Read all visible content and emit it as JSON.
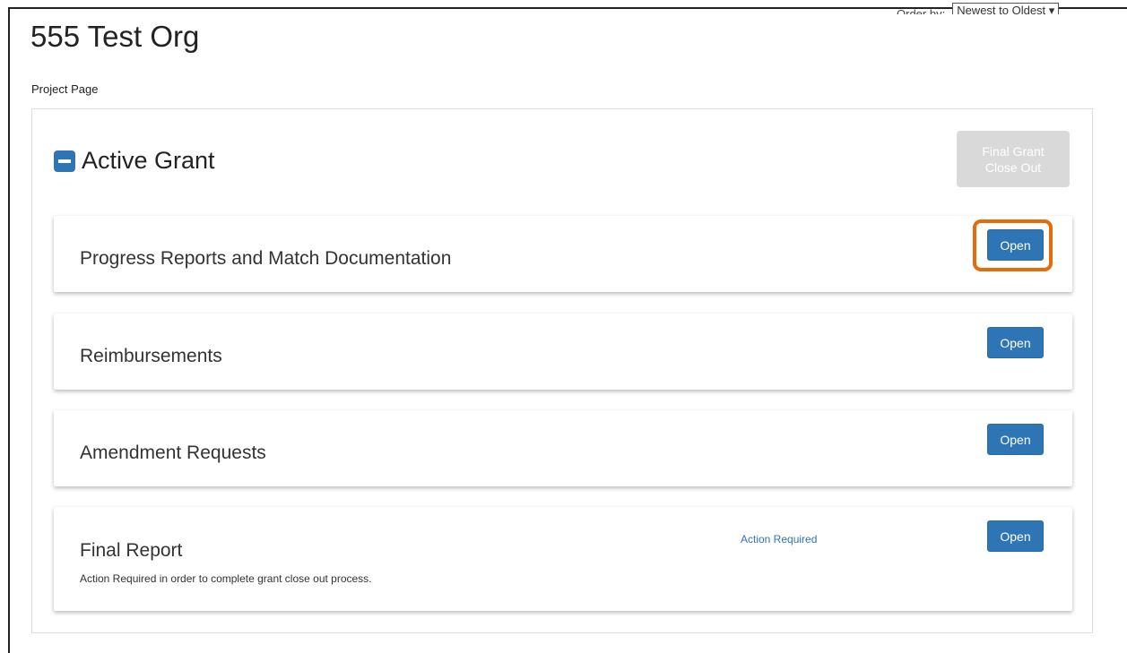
{
  "header": {
    "org_title": "555 Test Org",
    "order_by_label": "Order by:",
    "order_by_value": "Newest to Oldest ▾",
    "breadcrumb": "Project Page"
  },
  "section": {
    "title": "Active Grant",
    "close_out_label": "Final Grant Close Out"
  },
  "cards": [
    {
      "title": "Progress Reports and Match Documentation",
      "button": "Open",
      "highlighted": true
    },
    {
      "title": "Reimbursements",
      "button": "Open"
    },
    {
      "title": "Amendment Requests",
      "button": "Open"
    },
    {
      "title": "Final Report",
      "button": "Open",
      "badge": "Action Required",
      "note": "Action Required in order to complete grant close out process."
    }
  ],
  "colors": {
    "primary": "#2e75b6",
    "highlight": "#e46c0a",
    "disabled": "#d9d9d9"
  }
}
